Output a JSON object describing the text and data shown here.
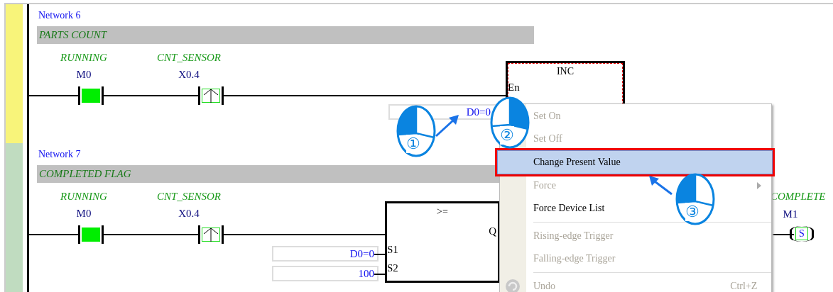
{
  "networks": [
    {
      "title": "Network 6",
      "comment": "PARTS COUNT",
      "color": "#f8f47a",
      "contacts": [
        {
          "label": "RUNNING",
          "address": "M0",
          "kind": "contact",
          "on": true
        },
        {
          "label": "CNT_SENSOR",
          "address": "X0.4",
          "kind": "rising_edge",
          "on": false
        }
      ],
      "block": {
        "name": "INC",
        "selected": true,
        "pins": [
          "En"
        ],
        "fields": [
          {
            "value": "D0=0"
          }
        ]
      }
    },
    {
      "title": "Network 7",
      "comment": "COMPLETED FLAG",
      "color": "#c0dcc0",
      "contacts": [
        {
          "label": "RUNNING",
          "address": "M0",
          "kind": "contact",
          "on": true
        },
        {
          "label": "CNT_SENSOR",
          "address": "X0.4",
          "kind": "rising_edge",
          "on": false
        }
      ],
      "block": {
        "name": ">=",
        "selected": false,
        "pins": [
          "Q",
          "S1",
          "S2"
        ],
        "fields": [
          {
            "value": "D0=0"
          },
          {
            "value": "100"
          }
        ]
      },
      "coil": {
        "label": "COMPLETE",
        "address": "M1",
        "symbol": "S"
      }
    }
  ],
  "context_menu": {
    "items": [
      {
        "kind": "item",
        "label": "Set On",
        "disabled": true,
        "selected": false
      },
      {
        "kind": "item",
        "label": "Set Off",
        "disabled": true,
        "selected": false
      },
      {
        "kind": "item",
        "label": "Change Present Value",
        "disabled": false,
        "selected": true
      },
      {
        "kind": "item",
        "label": "Force",
        "disabled": true,
        "selected": false,
        "submenu": true
      },
      {
        "kind": "item",
        "label": "Force Device List",
        "disabled": false,
        "selected": false
      },
      {
        "kind": "separator"
      },
      {
        "kind": "item",
        "label": "Rising-edge Trigger",
        "disabled": true,
        "selected": false
      },
      {
        "kind": "item",
        "label": "Falling-edge Trigger",
        "disabled": true,
        "selected": false
      },
      {
        "kind": "separator"
      },
      {
        "kind": "item",
        "label": "Undo",
        "disabled": true,
        "selected": false,
        "shortcut": "Ctrl+Z",
        "icon": true
      }
    ]
  },
  "callouts": [
    {
      "number": "①",
      "kind": "left_click"
    },
    {
      "number": "②",
      "kind": "right_click"
    },
    {
      "number": "③",
      "kind": "left_click"
    }
  ]
}
